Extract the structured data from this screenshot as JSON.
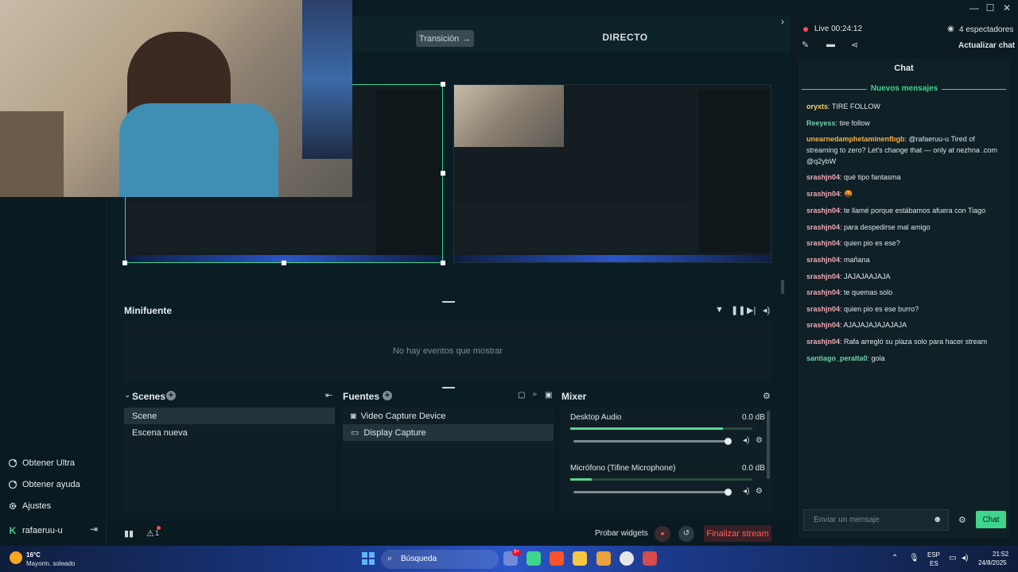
{
  "window": {
    "controls": [
      "—",
      "☐",
      "✕"
    ]
  },
  "toolbar": {
    "transition_label": "Transición",
    "directo_label": "DIRECTO"
  },
  "sidebar": {
    "items": [
      {
        "label": "Obtener Ultra",
        "icon": "ultra-icon"
      },
      {
        "label": "Obtener ayuda",
        "icon": "help-icon"
      },
      {
        "label": "Ajustes",
        "icon": "gear-icon"
      }
    ],
    "user": "rafaeruu-u"
  },
  "minifuente": {
    "title": "Minifuente",
    "empty_text": "No hay eventos que mostrar"
  },
  "scenes": {
    "title": "Scenes",
    "items": [
      "Scene",
      "Escena nueva"
    ],
    "selected": 0
  },
  "sources": {
    "title": "Fuentes",
    "items": [
      {
        "label": "Video Capture Device",
        "icon": "camera-icon"
      },
      {
        "label": "Display Capture",
        "icon": "monitor-icon"
      }
    ],
    "selected": 1
  },
  "mixer": {
    "title": "Mixer",
    "channels": [
      {
        "name": "Desktop Audio",
        "db": "0.0 dB",
        "level": 0.84,
        "volume": 1.0
      },
      {
        "name": "Micrófono (Tifine Microphone)",
        "db": "0.0 dB",
        "level": 0.12,
        "volume": 1.0
      }
    ]
  },
  "bottom": {
    "probar_widgets": "Probar widgets",
    "finalizar": "Finalizar stream",
    "alert_count": "1"
  },
  "live": {
    "status": "Live 00:24:12",
    "viewers": "4 espectadores",
    "refresh_chat": "Actualizar chat"
  },
  "chat": {
    "title": "Chat",
    "new_messages": "Nuevos mensajes",
    "messages": [
      {
        "user": "oryxts",
        "text": "TIRE FOLLOW",
        "color": "#f5d76e"
      },
      {
        "user": "Reeyess",
        "text": "tire follow",
        "color": "#6fd1a9"
      },
      {
        "user": "unearnedamphetaminenfbgb",
        "text": "@rafaeruu-u Tired of streaming to zero? Let's change that — only at nezhna .com @q2ybW",
        "color": "#f5b04a"
      },
      {
        "user": "srashjn04",
        "text": "qué tipo fantasma",
        "color": "#f2a8b3"
      },
      {
        "user": "srashjn04",
        "text": "🤬",
        "color": "#f2a8b3"
      },
      {
        "user": "srashjn04",
        "text": "te llamé porque estábamos afuera con Tiago",
        "color": "#f2a8b3"
      },
      {
        "user": "srashjn04",
        "text": "para despedirse mal amigo",
        "color": "#f2a8b3"
      },
      {
        "user": "srashjn04",
        "text": "quien pio es ese?",
        "color": "#f2a8b3"
      },
      {
        "user": "srashjn04",
        "text": "mañana",
        "color": "#f2a8b3"
      },
      {
        "user": "srashjn04",
        "text": "JAJAJAAJAJA",
        "color": "#f2a8b3"
      },
      {
        "user": "srashjn04",
        "text": "te quemas solo",
        "color": "#f2a8b3"
      },
      {
        "user": "srashjn04",
        "text": "quien pio es ese burro?",
        "color": "#f2a8b3"
      },
      {
        "user": "srashjn04",
        "text": "AJAJAJAJAJAJAJA",
        "color": "#f2a8b3"
      },
      {
        "user": "srashjn04",
        "text": "Rafa arregló su plaza solo para hacer stream",
        "color": "#f2a8b3"
      },
      {
        "user": "santiago_peralta0",
        "text": "gola",
        "color": "#6fd1a9"
      }
    ],
    "input_placeholder": "Enviar un mensaje",
    "send_label": "Chat"
  },
  "taskbar": {
    "weather_temp": "16°C",
    "weather_desc": "Mayorm. soleado",
    "search_label": "Búsqueda",
    "lang_top": "ESP",
    "lang_bottom": "ES",
    "time": "21:52",
    "date": "24/8/2025",
    "badge": "9+"
  },
  "colors": {
    "accent": "#3fd58c",
    "live_red": "#ff4b4b",
    "end_stream_red": "#ff5e5e"
  }
}
